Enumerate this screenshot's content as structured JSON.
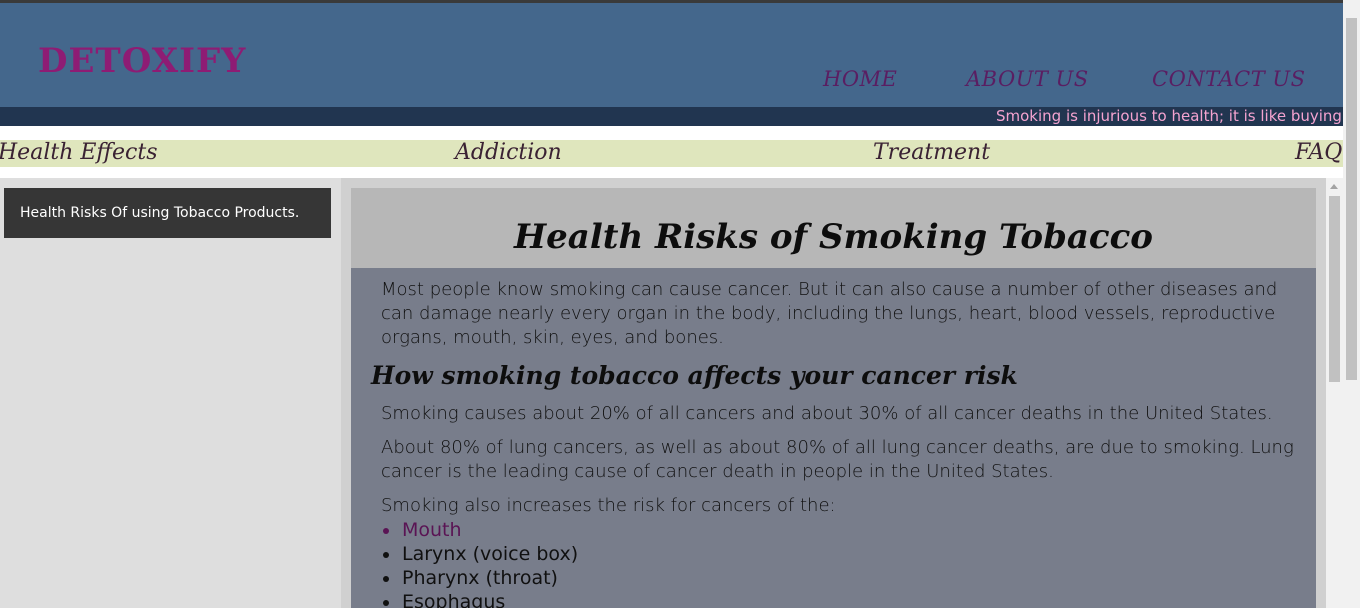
{
  "header": {
    "logo": "DETOXIFY",
    "nav": [
      "HOME",
      "ABOUT US",
      "CONTACT US"
    ]
  },
  "marquee": {
    "text": "Smoking is injurious to health; it is like buying"
  },
  "subnav": [
    "Health Effects",
    "Addiction",
    "Treatment",
    "FAQ"
  ],
  "sidebar": {
    "items": [
      "Health Risks Of using Tobacco Products."
    ]
  },
  "main": {
    "title": "Health Risks of Smoking Tobacco",
    "intro": "Most people know smoking can cause cancer. But it can also cause a number of other diseases and can damage nearly every organ in the body, including the lungs, heart, blood vessels, reproductive organs, mouth, skin, eyes, and bones.",
    "section_heading": "How smoking tobacco affects your cancer risk",
    "p1": "Smoking causes about 20% of all cancers and about 30% of all cancer deaths in the United States.",
    "p2": "About 80% of lung cancers, as well as about 80% of all lung cancer deaths, are due to smoking. Lung cancer is the leading cause of cancer death in people in the United States.",
    "p3": "Smoking also increases the risk for cancers of the:",
    "list": [
      "Mouth",
      "Larynx (voice box)",
      "Pharynx (throat)",
      "Esophagus"
    ]
  },
  "colors": {
    "header_bg": "#44678c",
    "logo": "#8e1c74",
    "nav_link": "#5a1e62",
    "marquee_bg": "#213550",
    "marquee_text": "#f4a3d0",
    "subnav_bg": "#dfe6bd",
    "sidebar_bg": "#dedede",
    "sidebar_button_bg": "#363636",
    "title_bar_bg": "#b7b7b7",
    "body_panel_bg": "#787d8b"
  }
}
